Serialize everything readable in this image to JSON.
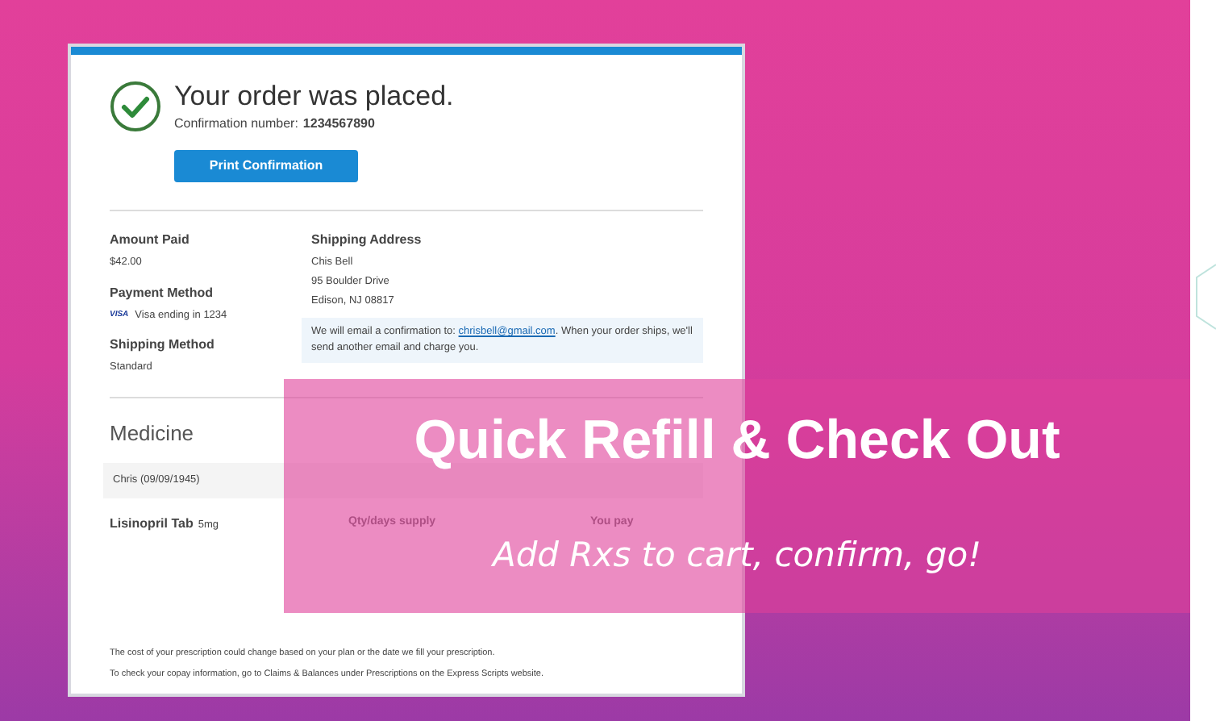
{
  "order": {
    "title": "Your order was placed.",
    "confirmation_label": "Confirmation number:",
    "confirmation_number": "1234567890",
    "print_button": "Print Confirmation",
    "amount_paid": {
      "label": "Amount Paid",
      "value": "$42.00"
    },
    "payment_method": {
      "label": "Payment Method",
      "card_brand": "VISA",
      "value": "Visa ending in 1234"
    },
    "shipping_method": {
      "label": "Shipping Method",
      "value": "Standard"
    },
    "shipping_address": {
      "label": "Shipping Address",
      "lines": [
        "Chis Bell",
        "95 Boulder Drive",
        "Edison, NJ 08817"
      ]
    },
    "email_notice": {
      "before": "We will email a confirmation to:",
      "email": "chrisbell@gmail.com",
      "after": ". When your order ships, we'll send another email and charge you."
    },
    "medicine": {
      "heading": "Medicine",
      "patient": "Chris (09/09/1945)",
      "drug_name": "Lisinopril Tab",
      "drug_strength": "5mg",
      "qty_label": "Qty/days supply",
      "pay_label": "You pay"
    },
    "footnotes": [
      "The cost of your prescription could change based on your plan or the date we fill your prescription.",
      "To check your copay information, go to Claims & Balances under Prescriptions on the Express Scripts website."
    ]
  },
  "banner": {
    "title": "Quick Refill & Check Out",
    "subtitle": "Add Rxs to cart, confirm, go!"
  }
}
